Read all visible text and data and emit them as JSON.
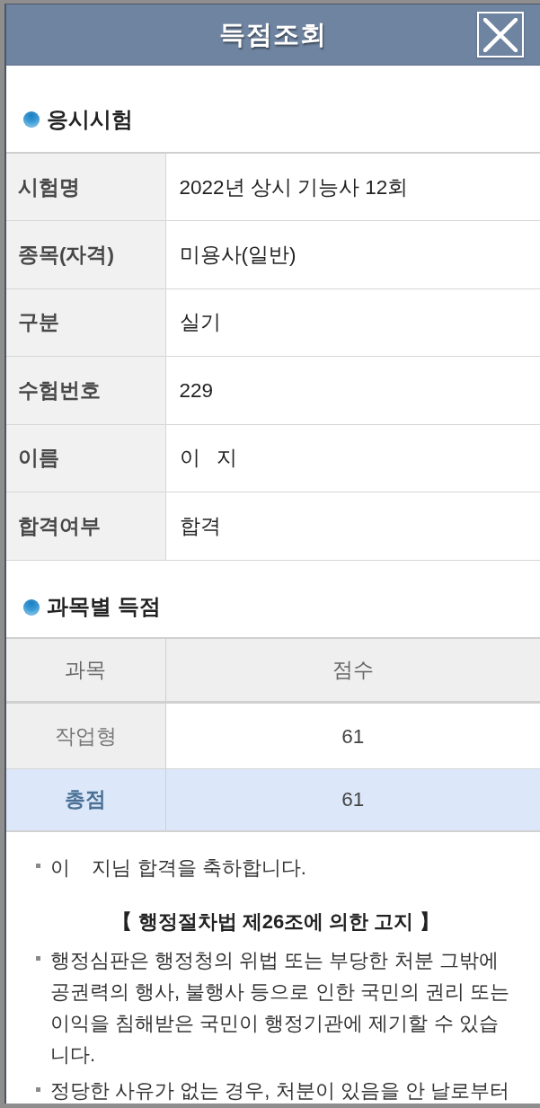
{
  "window": {
    "title": "득점조회"
  },
  "exam": {
    "title": "응시시험",
    "rows": [
      {
        "label": "시험명",
        "value": "2022년 상시 기능사 12회"
      },
      {
        "label": "종목(자격)",
        "value": "미용사(일반)"
      },
      {
        "label": "구분",
        "value": "실기"
      },
      {
        "label": "수험번호",
        "value": "229"
      },
      {
        "label": "이름",
        "value": "이   지"
      },
      {
        "label": "합격여부",
        "value": "합격"
      }
    ]
  },
  "scores": {
    "title": "과목별 득점",
    "columns": [
      "과목",
      "점수"
    ],
    "rows": [
      {
        "kind": "subject",
        "subject": "작업형",
        "score": "61"
      },
      {
        "kind": "total",
        "subject": "총점",
        "score": "61"
      }
    ]
  },
  "notices": [
    {
      "kind": "bullet",
      "text": "이    지님 합격을 축하합니다."
    },
    {
      "kind": "heading",
      "text": "【 행정절차법 제26조에 의한 고지 】"
    },
    {
      "kind": "bullet",
      "text": "행정심판은 행정청의 위법 또는 부당한 처분 그밖에 공권력의 행사, 불행사 등으로 인한 국민의 권리 또는 이익을 침해받은 국민이 행정기관에 제기할 수 있습니다."
    },
    {
      "kind": "bullet",
      "text": "정당한 사유가 없는 경우, 처분이 있음을 안 날로부터"
    }
  ]
}
